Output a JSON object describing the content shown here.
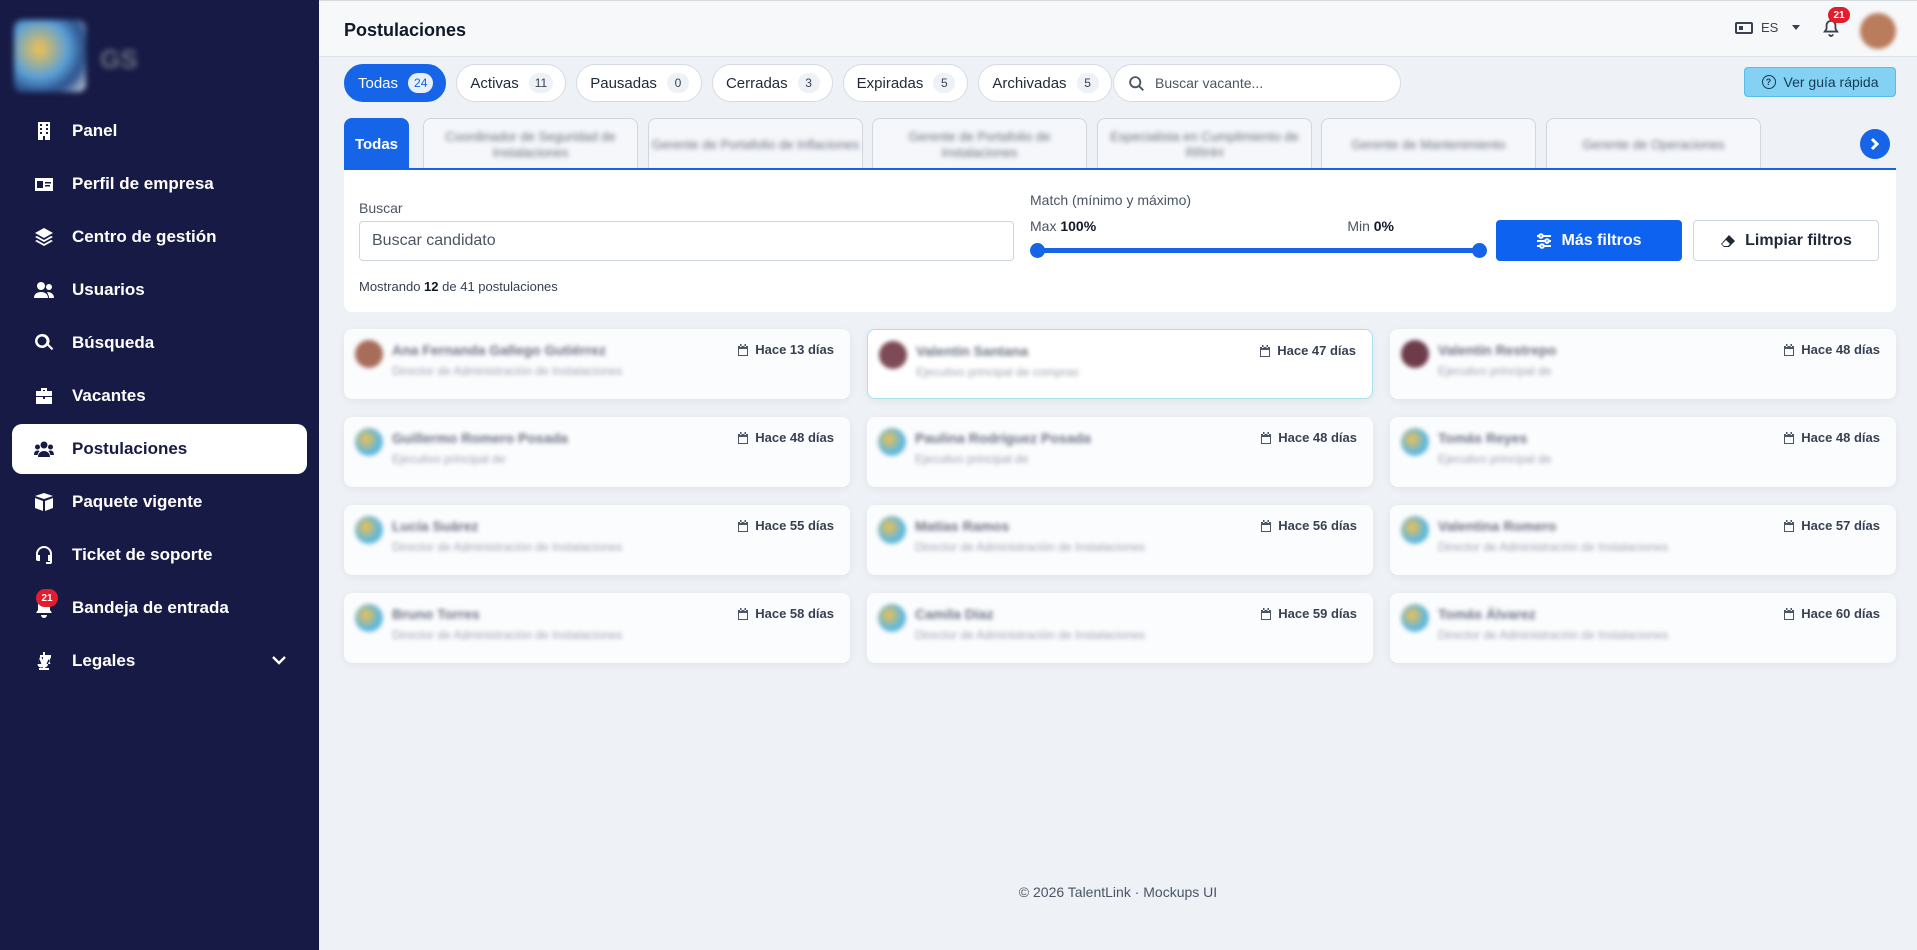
{
  "sidebar": {
    "logo_text": "GS",
    "items": [
      {
        "label": "Panel",
        "icon": "building-icon"
      },
      {
        "label": "Perfil de empresa",
        "icon": "id-card-icon"
      },
      {
        "label": "Centro de gestión",
        "icon": "layers-icon"
      },
      {
        "label": "Usuarios",
        "icon": "users-icon"
      },
      {
        "label": "Búsqueda",
        "icon": "search-icon"
      },
      {
        "label": "Vacantes",
        "icon": "briefcase-icon"
      },
      {
        "label": "Postulaciones",
        "icon": "users-group-icon",
        "active": true
      },
      {
        "label": "Paquete vigente",
        "icon": "box-icon"
      },
      {
        "label": "Ticket de soporte",
        "icon": "headset-icon"
      },
      {
        "label": "Bandeja de entrada",
        "icon": "inbox-bell-icon",
        "badge": "21"
      },
      {
        "label": "Legales",
        "icon": "scale-icon"
      }
    ]
  },
  "header": {
    "title": "Postulaciones",
    "language": "ES",
    "notifications_count": "21"
  },
  "status_chips": [
    {
      "label": "Todas",
      "count": "24",
      "active": true
    },
    {
      "label": "Activas",
      "count": "11"
    },
    {
      "label": "Pausadas",
      "count": "0"
    },
    {
      "label": "Cerradas",
      "count": "3"
    },
    {
      "label": "Expiradas",
      "count": "5"
    },
    {
      "label": "Archivadas",
      "count": "5"
    }
  ],
  "search_vacancy": {
    "placeholder": "Buscar vacante..."
  },
  "guide_button": {
    "label": "Ver guía rápida"
  },
  "vacancy_tabs": {
    "active_label": "Todas",
    "items": [
      "Coordinador de Seguridad de Instalaciones",
      "Gerente de Portafolio de Inflaciones",
      "Gerente de Portafolio de Instalaciones",
      "Especialista en Cumplimiento de RRHH",
      "Gerente de Mantenimiento",
      "Gerente de Operaciones"
    ]
  },
  "filters": {
    "search_label": "Buscar",
    "search_placeholder": "Buscar candidato",
    "match_label": "Match (mínimo y máximo)",
    "max_label": "Max",
    "max_value": "100%",
    "min_label": "Min",
    "min_value": "0%",
    "more_filters": "Más filtros",
    "clear_filters": "Limpiar filtros",
    "showing_prefix": "Mostrando",
    "showing_count": "12",
    "showing_suffix": "de 41 postulaciones"
  },
  "candidates": [
    {
      "name": "Ana Fernanda Gallego Gutiérrez",
      "subtitle": "Director de Administración de Instalaciones",
      "date": "Hace 13 días"
    },
    {
      "name": "Valentín Santana",
      "subtitle": "Ejecutivo principal de compras",
      "date": "Hace 47 días"
    },
    {
      "name": "Valentín Restrepo",
      "subtitle": "Ejecutivo principal de",
      "date": "Hace 48 días"
    },
    {
      "name": "Guillermo Romero Posada",
      "subtitle": "Ejecutivo principal de",
      "date": "Hace 48 días"
    },
    {
      "name": "Paulina Rodríguez Posada",
      "subtitle": "Ejecutivo principal de",
      "date": "Hace 48 días"
    },
    {
      "name": "Tomás Reyes",
      "subtitle": "Ejecutivo principal de",
      "date": "Hace 48 días"
    },
    {
      "name": "Lucía Suárez",
      "subtitle": "Director de Administración de Instalaciones",
      "date": "Hace 55 días"
    },
    {
      "name": "Matías Ramos",
      "subtitle": "Director de Administración de Instalaciones",
      "date": "Hace 56 días"
    },
    {
      "name": "Valentina Romero",
      "subtitle": "Director de Administración de Instalaciones",
      "date": "Hace 57 días"
    },
    {
      "name": "Bruno Torres",
      "subtitle": "Director de Administración de Instalaciones",
      "date": "Hace 58 días"
    },
    {
      "name": "Camila Díaz",
      "subtitle": "Director de Administración de Instalaciones",
      "date": "Hace 59 días"
    },
    {
      "name": "Tomás Álvarez",
      "subtitle": "Director de Administración de Instalaciones",
      "date": "Hace 60 días"
    }
  ],
  "footer": "© 2026 TalentLink · Mockups UI",
  "colors": {
    "sidebar_bg": "#161a45",
    "primary": "#1664e8",
    "badge_red": "#e11d2e",
    "guide_bg": "#83d2f3"
  }
}
